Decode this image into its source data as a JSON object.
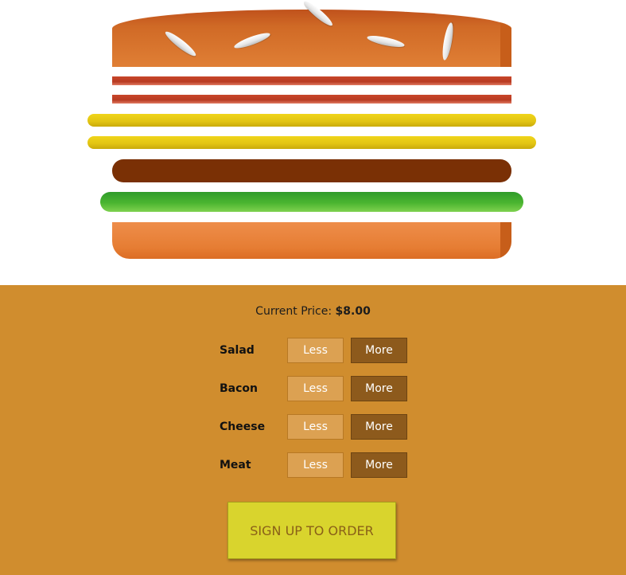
{
  "price": {
    "label": "Current Price:",
    "value": "$8.00"
  },
  "ingredients": [
    {
      "name": "Salad",
      "less_label": "Less",
      "more_label": "More"
    },
    {
      "name": "Bacon",
      "less_label": "Less",
      "more_label": "More"
    },
    {
      "name": "Cheese",
      "less_label": "Less",
      "more_label": "More"
    },
    {
      "name": "Meat",
      "less_label": "Less",
      "more_label": "More"
    }
  ],
  "order_button": "SIGN UP TO ORDER",
  "colors": {
    "panel_background": "#d08d2e",
    "less_button": "#dca152",
    "more_button": "#8d5a1c",
    "order_button": "#d9d42d",
    "order_text": "#8a6018",
    "bun": "#e07f35",
    "bacon": "#c8462a",
    "cheese": "#e2c412",
    "meat": "#7a3005",
    "salad": "#4bb530"
  },
  "burger_layers": {
    "bacon_count": 2,
    "cheese_count": 2,
    "meat_count": 1,
    "salad_count": 1
  }
}
